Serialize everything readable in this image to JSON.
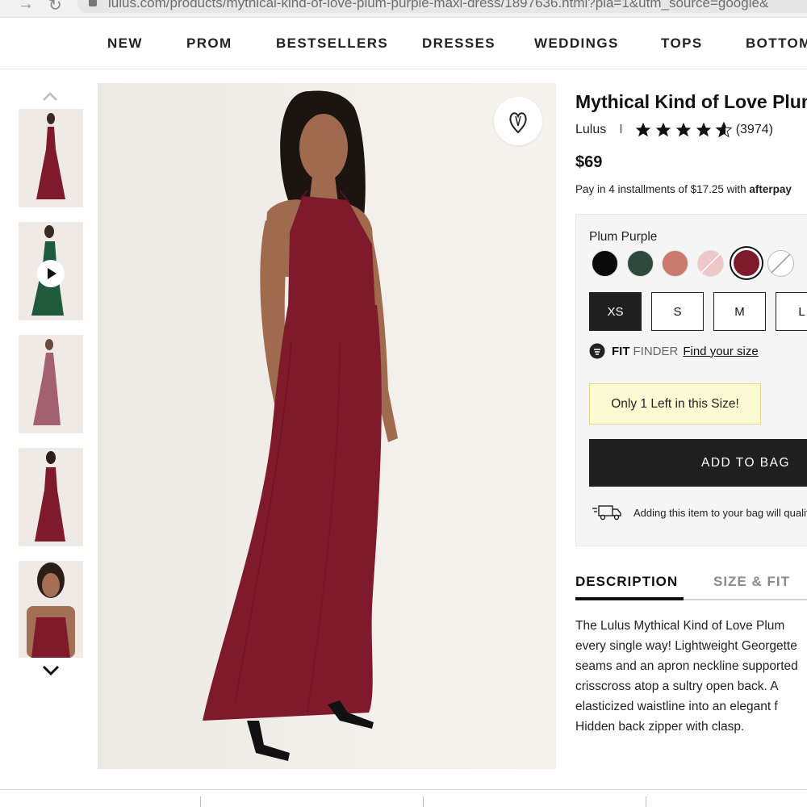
{
  "browser": {
    "url": "lulus.com/products/mythical-kind-of-love-plum-purple-maxi-dress/1897636.html?pla=1&utm_source=google&"
  },
  "nav": {
    "items": [
      "NEW",
      "PROM",
      "BESTSELLERS",
      "DRESSES",
      "WEDDINGS",
      "TOPS",
      "BOTTOMS"
    ]
  },
  "thumbnails": [
    {
      "color": "#7c1d2b",
      "kind": "image"
    },
    {
      "color": "#1f5a3c",
      "kind": "video"
    },
    {
      "color": "#9b5a6a",
      "kind": "image"
    },
    {
      "color": "#7c1d2b",
      "kind": "image"
    },
    {
      "color": "#7c1d2b",
      "kind": "image"
    }
  ],
  "product": {
    "title": "Mythical Kind of Love Plum",
    "brand": "Lulus",
    "separator": "I",
    "rating": 4.5,
    "review_count": "(3974)",
    "price": "$69",
    "installments_prefix": "Pay in 4 installments of ",
    "installments_amount": "$17.25",
    "installments_suffix": " with ",
    "installments_provider": "afterpay",
    "selected_color": "Plum Purple",
    "colors": [
      {
        "name": "black",
        "hex": "#0a0a0a"
      },
      {
        "name": "hunter-green",
        "hex": "#2f4a3d"
      },
      {
        "name": "rust-pink",
        "hex": "#c97a6c"
      },
      {
        "name": "blush",
        "hex": "#efc7c7"
      },
      {
        "name": "plum-purple",
        "hex": "#7e1a2c"
      },
      {
        "name": "white",
        "hex": "#ffffff"
      }
    ],
    "sizes": [
      "XS",
      "S",
      "M",
      "L"
    ],
    "selected_size": "XS",
    "fit_label": "FIT",
    "finder_label": "FINDER",
    "find_size_link": "Find your size",
    "stock_notice": "Only 1 Left in this Size!",
    "add_to_bag": "ADD TO BAG",
    "shipping_note": "Adding this item to your bag will qualify"
  },
  "tabs": {
    "description": "DESCRIPTION",
    "size_fit": "SIZE & FIT"
  },
  "description_lines": [
    "The Lulus Mythical Kind of Love Plum",
    "every single way! Lightweight Georgette",
    "seams and an apron neckline supported",
    "crisscross atop a sultry open back. A",
    "elasticized waistline into an elegant f",
    "Hidden back zipper with clasp."
  ],
  "colors": {
    "accent": "#1f1f1f",
    "dress": "#7e1a2c",
    "stock_bg": "#fdfbd3"
  }
}
